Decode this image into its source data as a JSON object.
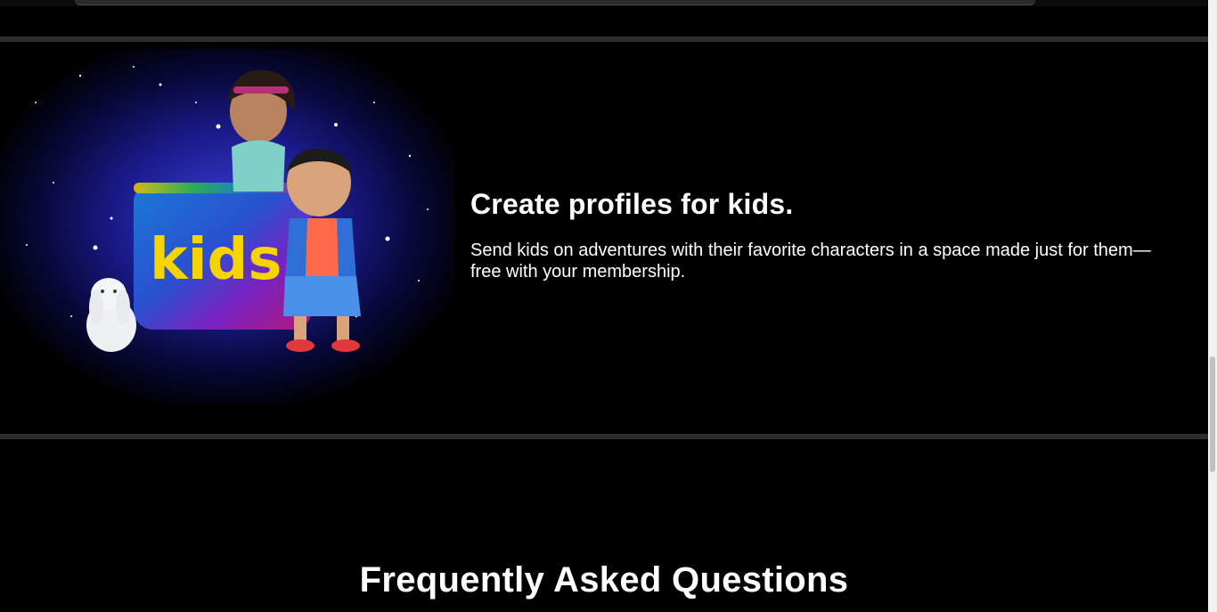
{
  "kids_feature": {
    "title": "Create profiles for kids.",
    "description": "Send kids on adventures with their favorite characters in a space made just for them—free with your membership.",
    "badge_text": "kids",
    "image_icon": "kids-profile-illustration"
  },
  "faq": {
    "title": "Frequently Asked Questions"
  },
  "colors": {
    "background": "#000000",
    "divider": "#2d2d2d",
    "text": "#ffffff",
    "badge_yellow": "#f5d400"
  }
}
